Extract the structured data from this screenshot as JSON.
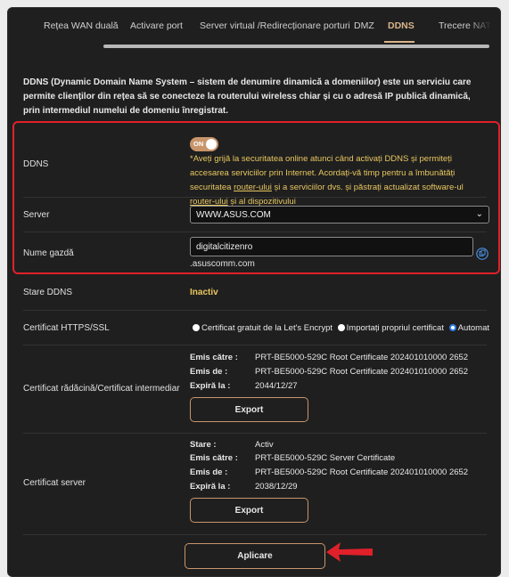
{
  "tabs": [
    {
      "label": "Rețea WAN duală"
    },
    {
      "label": "Activare port"
    },
    {
      "label": "Server virtual /Redirecționare porturi"
    },
    {
      "label": "DMZ"
    },
    {
      "label": "DDNS",
      "active": true
    },
    {
      "label": "Trecere NAT"
    }
  ],
  "description": "DDNS (Dynamic Domain Name System – sistem de denumire dinamică a domeniilor) este un serviciu care permite clienților din rețea să se conecteze la routerului wireless chiar și cu o adresă IP publică dinamică, prin intermediul numelui de domeniu înregistrat.",
  "ddns": {
    "label": "DDNS",
    "toggle_text": "ON",
    "toggle_on": true,
    "note_part1": "*Aveți grijă la securitatea online atunci când activați DDNS și permiteți accesarea serviciilor prin Internet. Acordați-vă timp pentru a îmbunătăți securitatea ",
    "note_link1": "router-ului",
    "note_part2": " și a serviciilor dvs. și păstrați actualizat software-ul ",
    "note_link2": "router-ului",
    "note_part3": " și al dispozitivului"
  },
  "server": {
    "label": "Server",
    "value": "WWW.ASUS.COM"
  },
  "hostname": {
    "label": "Nume gazdă",
    "value": "digitalcitizenro",
    "suffix": ".asuscomm.com"
  },
  "status": {
    "label": "Stare DDNS",
    "value": "Inactiv"
  },
  "https": {
    "label": "Certificat HTTPS/SSL",
    "options": [
      {
        "label": "Certificat gratuit de la Let's Encrypt",
        "checked": false
      },
      {
        "label": "Importați propriul certificat",
        "checked": false
      },
      {
        "label": "Automat",
        "checked": true
      }
    ]
  },
  "root_cert": {
    "label": "Certificat rădăcină/Certificat intermediar",
    "issued_to_label": "Emis către :",
    "issued_to": "PRT-BE5000-529C Root Certificate 202401010000 2652",
    "issued_by_label": "Emis de :",
    "issued_by": "PRT-BE5000-529C Root Certificate 202401010000 2652",
    "expires_label": "Expiră la :",
    "expires": "2044/12/27",
    "export_label": "Export"
  },
  "server_cert": {
    "label": "Certificat server",
    "state_label": "Stare :",
    "state": "Activ",
    "issued_to_label": "Emis către :",
    "issued_to": "PRT-BE5000-529C Server Certificate",
    "issued_by_label": "Emis de :",
    "issued_by": "PRT-BE5000-529C Root Certificate 202401010000 2652",
    "expires_label": "Expiră la :",
    "expires": "2038/12/29",
    "export_label": "Export"
  },
  "apply_label": "Aplicare",
  "colors": {
    "accent": "#c8956b",
    "highlight": "#e0202a",
    "warning_text": "#e8c760",
    "background": "#1f1f1f"
  }
}
